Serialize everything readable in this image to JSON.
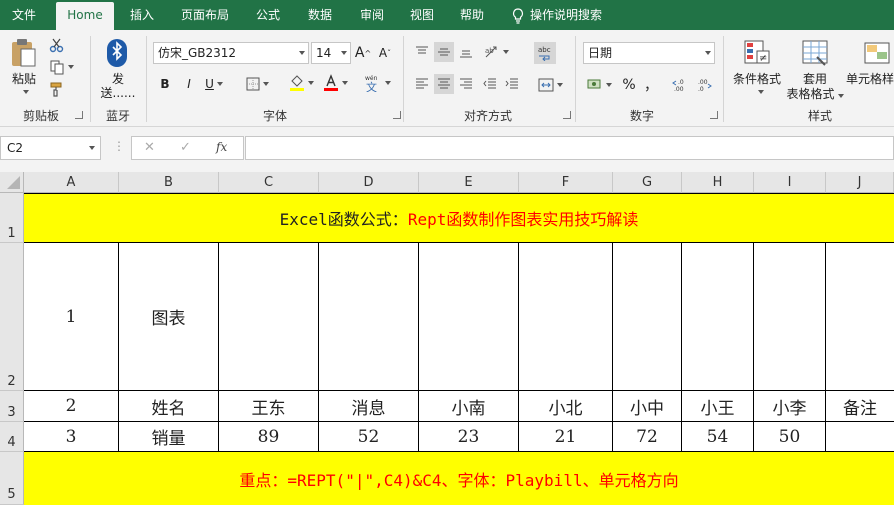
{
  "menu": {
    "tabs": [
      "文件",
      "Home",
      "插入",
      "页面布局",
      "公式",
      "数据",
      "审阅",
      "视图",
      "帮助"
    ],
    "search": "操作说明搜索"
  },
  "ribbon": {
    "clipboard": {
      "paste": "粘贴",
      "label": "剪贴板"
    },
    "bluetooth": {
      "send": "发",
      "send2": "送......",
      "label": "蓝牙"
    },
    "font": {
      "family": "仿宋_GB2312",
      "size": "14",
      "label": "字体",
      "bold": "B",
      "italic": "I",
      "underline": "U",
      "grow": "A",
      "shrink": "A"
    },
    "align": {
      "label": "对齐方式"
    },
    "number": {
      "format": "日期",
      "percent": "%",
      "comma": "，",
      "label": "数字"
    },
    "styles": {
      "cond": "条件格式",
      "table1": "套用",
      "table2": "表格格式",
      "cell": "单元格样",
      "label": "样式"
    },
    "accent": "#217346"
  },
  "formula": {
    "namebox": "C2",
    "cancel": "✕",
    "enter": "✓",
    "fx": "fx",
    "value": ""
  },
  "sheet": {
    "columns": [
      "A",
      "B",
      "C",
      "D",
      "E",
      "F",
      "G",
      "H",
      "I",
      "J"
    ],
    "rows": [
      "1",
      "2",
      "3",
      "4",
      "5"
    ],
    "title_black": "Excel函数公式：",
    "title_red": "Rept函数制作图表实用技巧解读",
    "row2": {
      "a": "1",
      "b": "图表"
    },
    "row3": [
      "2",
      "姓名",
      "王东",
      "消息",
      "小南",
      "小北",
      "小中",
      "小王",
      "小李",
      "备注"
    ],
    "row4": [
      "3",
      "销量",
      "89",
      "52",
      "23",
      "21",
      "72",
      "54",
      "50",
      ""
    ],
    "footer": "重点：=REPT(\"|\",C4)&C4、字体：Playbill、单元格方向",
    "highlight": "#ffff00"
  }
}
